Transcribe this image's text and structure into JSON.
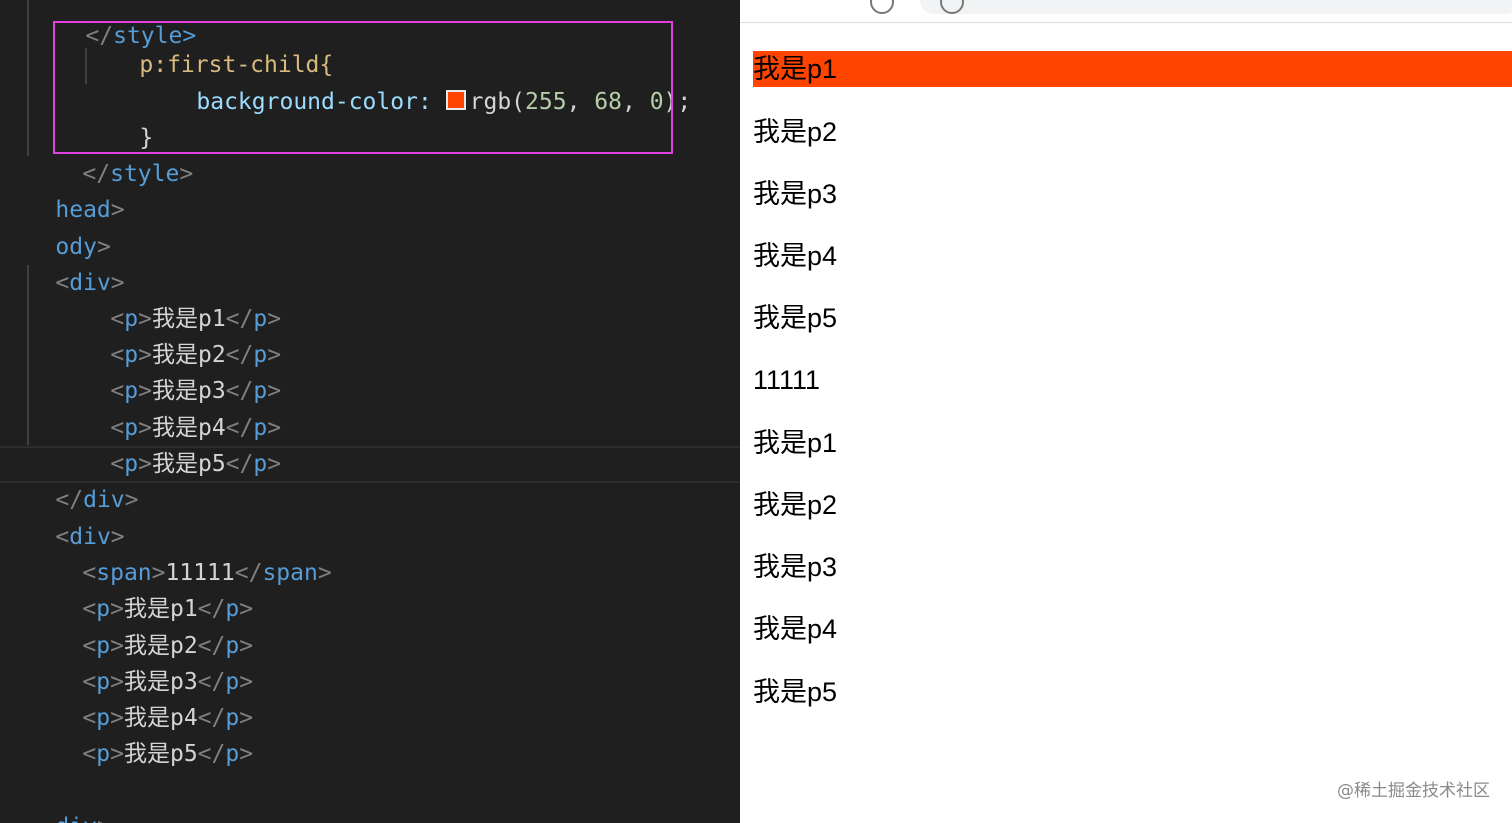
{
  "editor": {
    "lines": {
      "l0": "style>",
      "l1_sel": "p:first-child{",
      "l2_prop": "background-color: ",
      "l2_val_pre": "rgb(",
      "l2_n1": "255",
      "l2_n2": "68",
      "l2_n3": "0",
      "l2_val_post": ");",
      "l3": "}",
      "l4_tag": "style",
      "l5_tag": "head",
      "l6_tag": "ody",
      "l7_tag": "div",
      "div1_items": [
        "我是p1",
        "我是p2",
        "我是p3",
        "我是p4",
        "我是p5"
      ],
      "l13_tag": "div",
      "l14_tag": "div",
      "span_tag": "span",
      "span_text": "11111",
      "p_tag": "p",
      "div2_items": [
        "我是p1",
        "我是p2",
        "我是p3",
        "我是p4",
        "我是p5"
      ],
      "l21_tag": "div"
    },
    "accent_color": "#ff4400",
    "highlight_box_color": "#e040e0"
  },
  "browser": {
    "paragraphs": [
      "我是p1",
      "我是p2",
      "我是p3",
      "我是p4",
      "我是p5",
      "11111",
      "我是p1",
      "我是p2",
      "我是p3",
      "我是p4",
      "我是p5"
    ],
    "first_child_bg": "#ff4400",
    "watermark": "@稀土掘金技术社区"
  }
}
